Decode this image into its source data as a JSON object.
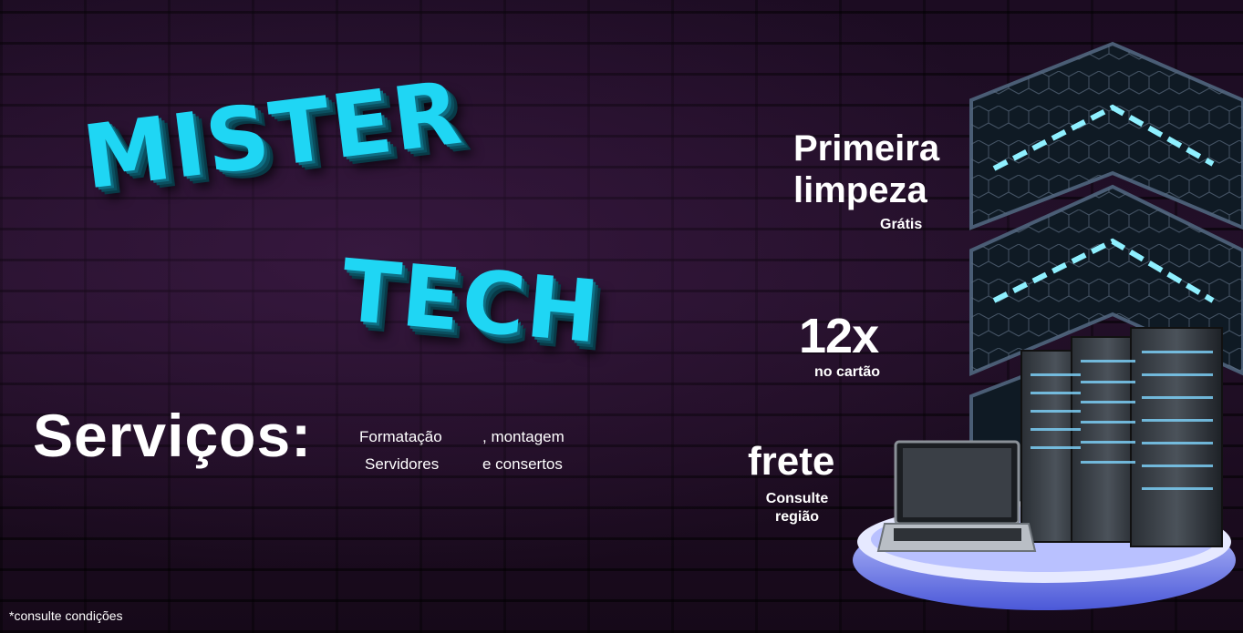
{
  "brand": {
    "line1": "MISTER",
    "line2": "TECH"
  },
  "services": {
    "title": "Serviços:",
    "items": [
      "Formatação",
      ", montagem",
      "Servidores",
      "e consertos"
    ]
  },
  "offers": [
    {
      "title": "Primeira limpeza",
      "subtitle": "Grátis"
    },
    {
      "title": "12x",
      "subtitle": "no cartão"
    },
    {
      "title": "frete",
      "subtitle": "Consulte região"
    }
  ],
  "footnote": "*consulte condições",
  "colors": {
    "accent": "#1fd6f4",
    "background": "#1c0c22",
    "text": "#ffffff",
    "platform": "#5b6cf0"
  },
  "icons": [
    "chevron-panel-icon",
    "server-rack-icon",
    "laptop-icon",
    "platform-icon"
  ]
}
